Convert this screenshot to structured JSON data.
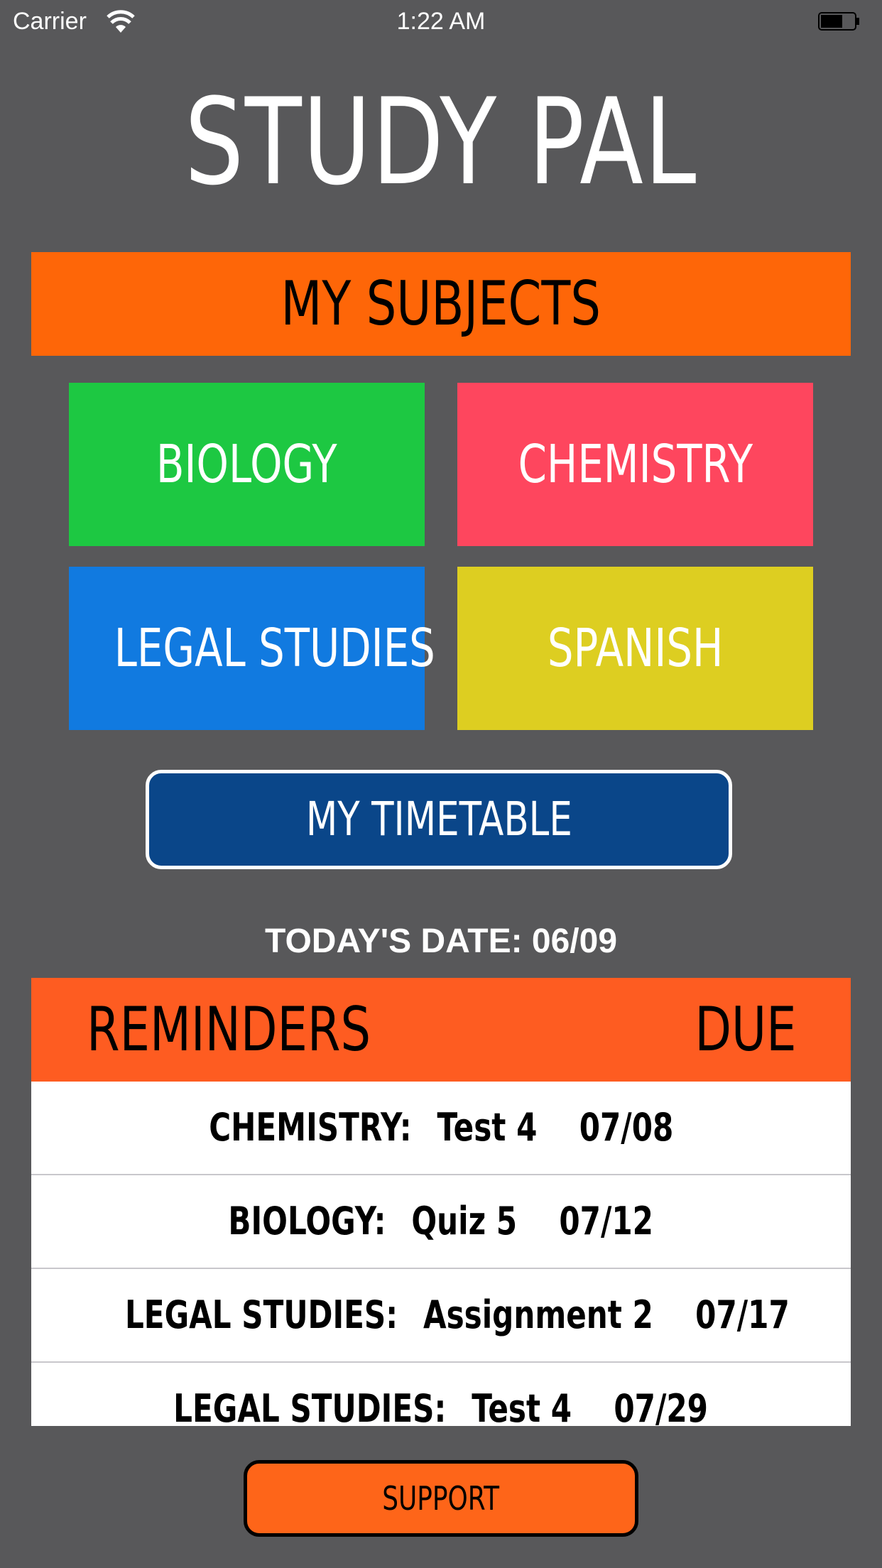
{
  "status_bar": {
    "carrier": "Carrier",
    "time": "1:22 AM",
    "wifi_icon": "wifi-icon",
    "battery_icon": "battery-icon"
  },
  "app_title": "STUDY PAL",
  "subjects": {
    "header": "MY SUBJECTS",
    "items": [
      {
        "label": "BIOLOGY",
        "color": "#1dc842"
      },
      {
        "label": "CHEMISTRY",
        "color": "#fe465e"
      },
      {
        "label": "LEGAL STUDIES",
        "color": "#117ae0"
      },
      {
        "label": "SPANISH",
        "color": "#ddce21"
      }
    ]
  },
  "timetable_button": "MY TIMETABLE",
  "today_date": "TODAY'S DATE: 06/09",
  "reminders": {
    "header_title": "REMINDERS",
    "header_due": "DUE",
    "rows": [
      {
        "subject": "CHEMISTRY:",
        "task": "Test 4",
        "due": "07/08"
      },
      {
        "subject": "BIOLOGY:",
        "task": "Quiz 5",
        "due": "07/12"
      },
      {
        "subject": "LEGAL STUDIES:",
        "task": "Assignment 2",
        "due": "07/17"
      },
      {
        "subject": "LEGAL STUDIES:",
        "task": "Test 4",
        "due": "07/29"
      }
    ]
  },
  "support_button": "SUPPORT",
  "colors": {
    "background": "#58585a",
    "accent_orange": "#fe6608",
    "reminders_orange": "#fe5c21",
    "timetable_blue": "#0a4689"
  }
}
